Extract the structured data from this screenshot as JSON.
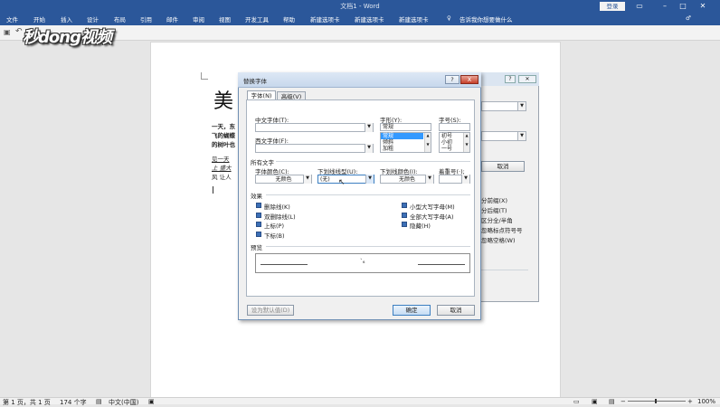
{
  "window": {
    "title": "文档1 - Word",
    "login": "登录",
    "menu_tabs": [
      "文件",
      "开始",
      "插入",
      "设计",
      "布局",
      "引用",
      "邮件",
      "审阅",
      "视图",
      "开发工具",
      "帮助",
      "新建选项卡",
      "新建选项卡",
      "新建选项卡"
    ],
    "tell_me": "告诉我你想要做什么",
    "logo": "秒dong视频"
  },
  "document": {
    "big_char": "美",
    "line1": "一天，东",
    "line2": "飞的蝴蝶",
    "line3": "的树叶也",
    "line4": "见一天",
    "line5": "上  盛大",
    "line6": "风  让人"
  },
  "bg_dialog": {
    "cancel": "取消",
    "items": [
      "分前缀(X)",
      "分后缀(T)",
      "区分全/半角",
      "忽略标点符号号",
      "忽略空格(W)"
    ]
  },
  "dialog": {
    "title": "替换字体",
    "tabs": [
      "字体(N)",
      "高级(V)"
    ],
    "labels": {
      "chinese_font": "中文字体(T):",
      "western_font": "西文字体(F):",
      "style": "字形(Y):",
      "size": "字号(S):",
      "all_text": "所有文字",
      "font_color": "字体颜色(C):",
      "underline_type": "下划线线型(U):",
      "underline_color": "下划线颜色(I):",
      "emphasis": "着重号(·);",
      "effects": "效果",
      "preview": "预览"
    },
    "style_value": "常规",
    "style_options": [
      "常规",
      "倾斜",
      "加粗"
    ],
    "size_options": [
      "初号",
      "小初",
      "一号"
    ],
    "font_color_value": "无颜色",
    "underline_value": "(无)",
    "underline_color_value": "无颜色",
    "effects_left": [
      "删除线(K)",
      "双删除线(L)",
      "上标(P)",
      "下标(B)"
    ],
    "effects_right": [
      "小型大写字母(M)",
      "全部大写字母(A)",
      "隐藏(H)"
    ],
    "preview_mark": "`₆",
    "buttons": {
      "default": "设为默认值(D)",
      "ok": "确定",
      "cancel": "取消"
    },
    "title_buttons": {
      "help": "?",
      "close": "X"
    }
  },
  "status": {
    "page": "第 1 页，共 1 页",
    "words": "174 个字",
    "lang": "中文(中国)",
    "zoom": "100%"
  }
}
